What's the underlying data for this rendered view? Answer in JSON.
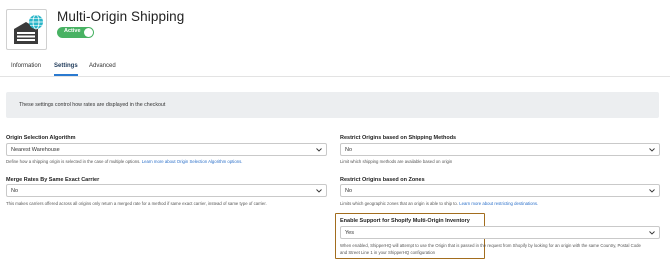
{
  "header": {
    "title": "Multi-Origin Shipping",
    "status": "Active"
  },
  "tabs": [
    {
      "label": "Information"
    },
    {
      "label": "Settings",
      "active": true
    },
    {
      "label": "Advanced"
    }
  ],
  "banner": {
    "text": "These settings control how rates are displayed in the checkout"
  },
  "fields": {
    "origin_selection": {
      "label": "Origin Selection Algorithm",
      "value": "Nearest Warehouse",
      "help": "Define how a shipping origin is selected in the case of multiple options.",
      "link": "Learn more about Origin Selection Algorithm options."
    },
    "restrict_methods": {
      "label": "Restrict Origins based on Shipping Methods",
      "value": "No",
      "help": "Limit which shipping methods are available based on origin"
    },
    "merge_rates": {
      "label": "Merge Rates By Same Exact Carrier",
      "value": "No",
      "help": "This makes carriers offered across all origins only return a merged rate for a method if same exact carrier, instead of same type of carrier."
    },
    "restrict_zones": {
      "label": "Restrict Origins based on Zones",
      "value": "No",
      "help": "Limits which geographic zones that an origin is able to ship to.",
      "link": "Learn more about restricting destinations."
    },
    "shopify_support": {
      "label": "Enable Support for Shopify Multi-Origin Inventory",
      "value": "Yes",
      "help_line1": "When enabled, ShipperHQ will attempt to use the Origin that is passed in the request from Shopify by looking for an origin with the same Country, Postal Code",
      "help_line2": "and Street Line 1 in your ShipperHQ configuration"
    }
  },
  "colors": {
    "active_toggle": "#48b263",
    "tab_underline": "#2a7ad0",
    "link": "#2a6fc9",
    "highlight_border": "#a26d1e",
    "app_icon_globe": "#2bb6c9"
  },
  "icons": {
    "app": "warehouse-globe-icon",
    "select_arrow": "chevron-down-icon"
  }
}
